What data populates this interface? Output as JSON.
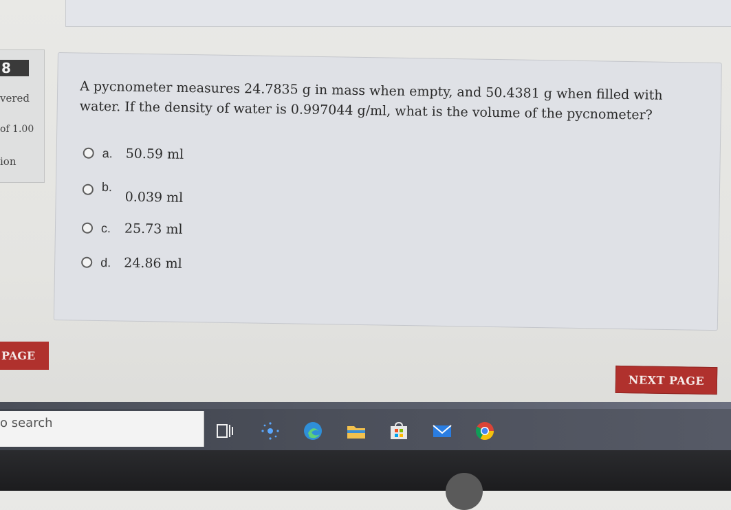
{
  "sidebar": {
    "question_number": "8",
    "answered_label": "vered",
    "marks_label": "of 1.00",
    "flag_label": "ion"
  },
  "question": {
    "text": "A pycnometer measures 24.7835 g in mass when empty, and 50.4381 g when filled with water. If the density of water is 0.997044 g/ml, what is the volume of the pycnometer?",
    "options": [
      {
        "letter": "a.",
        "text": "50.59 ml"
      },
      {
        "letter": "b.",
        "text": "0.039 ml"
      },
      {
        "letter": "c.",
        "text": "25.73 ml"
      },
      {
        "letter": "d.",
        "text": "24.86 ml"
      }
    ]
  },
  "navigation": {
    "prev_label": "PAGE",
    "next_label": "NEXT PAGE"
  },
  "taskbar": {
    "search_placeholder": "o search",
    "icons": [
      "task-view-icon",
      "cortana-icon",
      "edge-icon",
      "file-explorer-icon",
      "store-icon",
      "mail-icon",
      "chrome-icon"
    ]
  },
  "colors": {
    "button_red": "#b0312d",
    "card_bg": "#dfe1e6",
    "taskbar_bg": "#4b4f5a"
  }
}
